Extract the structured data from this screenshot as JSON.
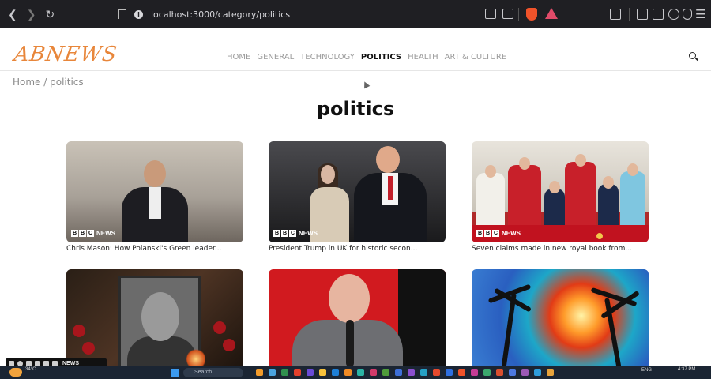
{
  "browser": {
    "url": "localhost:3000/category/politics",
    "nav_icons": [
      "back-icon",
      "forward-icon",
      "reload-icon"
    ]
  },
  "site": {
    "logo": "ABNEWS",
    "menu": [
      {
        "label": "HOME",
        "active": false
      },
      {
        "label": "GENERAL",
        "active": false
      },
      {
        "label": "TECHNOLOGY",
        "active": false
      },
      {
        "label": "POLITICS",
        "active": true
      },
      {
        "label": "HEALTH",
        "active": false
      },
      {
        "label": "ART & CULTURE",
        "active": false
      }
    ],
    "breadcrumb": "Home / politics",
    "page_title": "politics"
  },
  "articles": [
    {
      "caption": "Chris Mason: How Polanski's Green leader...",
      "source": "NEWS"
    },
    {
      "caption": "President Trump in UK for historic secon...",
      "source": "NEWS"
    },
    {
      "caption": "Seven claims made in new royal book from...",
      "source": "NEWS"
    },
    {
      "caption": "",
      "source": ""
    },
    {
      "caption": "",
      "source": ""
    },
    {
      "caption": "",
      "source": ""
    }
  ],
  "taskbar": {
    "weather": "34°C",
    "search_placeholder": "Search",
    "tray_lang": "ENG",
    "time": "4:37 PM"
  },
  "recorder": {
    "label": "NEWS"
  },
  "colors": {
    "logo": "#e8863a",
    "active_nav": "#111111",
    "nav": "#9a9a9a",
    "bbc_banner": "#c1121f"
  }
}
